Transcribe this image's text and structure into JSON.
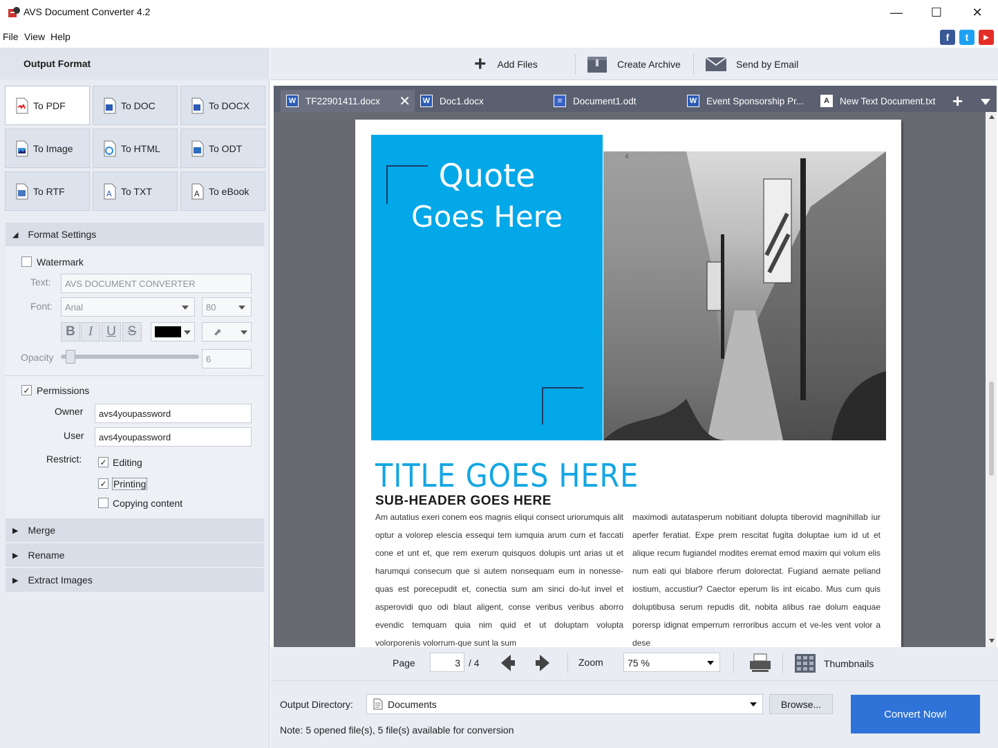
{
  "window": {
    "title": "AVS Document Converter 4.2"
  },
  "menu": [
    "File",
    "View",
    "Help"
  ],
  "social": [
    "f",
    "t",
    "▶"
  ],
  "colors": {
    "accent": "#2f73d8",
    "quote_box": "#02a8e8",
    "title_blue": "#14a6e3"
  },
  "left": {
    "output_format_label": "Output Format",
    "formats": [
      "To PDF",
      "To DOC",
      "To DOCX",
      "To Image",
      "To HTML",
      "To ODT",
      "To RTF",
      "To TXT",
      "To eBook"
    ],
    "selected_format": "To PDF",
    "format_settings": {
      "label": "Format Settings",
      "watermark_label": "Watermark",
      "watermark_checked": false,
      "text_label": "Text:",
      "text_value": "AVS DOCUMENT CONVERTER",
      "font_label": "Font:",
      "font_value": "Arial",
      "font_size": "80",
      "bold": "B",
      "italic": "I",
      "underline": "U",
      "strike": "S",
      "opacity_label": "Opacity",
      "opacity_value": "6",
      "permissions_label": "Permissions",
      "permissions_checked": true,
      "owner_label": "Owner",
      "owner_value": "avs4youpassword",
      "user_label": "User",
      "user_value": "avs4youpassword",
      "restrict_label": "Restrict:",
      "restrict_items": [
        "Editing",
        "Printing",
        "Copying content"
      ],
      "restrict_checked": [
        true,
        true,
        false
      ]
    },
    "sections": [
      "Merge",
      "Rename",
      "Extract Images"
    ]
  },
  "toolbar": {
    "add_files": "Add Files",
    "create_archive": "Create Archive",
    "send_email": "Send by Email"
  },
  "tabs": [
    "TF22901411.docx",
    "Doc1.docx",
    "Document1.odt",
    "Event Sponsorship Pr...",
    "New Text Document.txt"
  ],
  "document": {
    "quote_line1": "Quote",
    "quote_line2": "Goes Here",
    "photo_mark": "4",
    "title": "TITLE GOES HERE",
    "subheader": "SUB-HEADER GOES HERE",
    "col1": "Am autatius exeri conem eos magnis eliqui consect uriorumquis alit optur a volorep elescia essequi tem iumquia arum cum et faccati cone et unt et, que rem exerum quisquos dolupis unt arias ut et harumqui consecum que si autem nonsequam eum in nonesse-quas est porecepudit et, conectia sum am sinci do-lut invel et asperovidi quo odi blaut aligent, conse veribus veribus aborro evendic temquam quia nim quid et ut doluptam volupta volorporenis volorrum-que sunt la sum",
    "col2": "maximodi autatasperum nobitiant dolupta tiberovid magnihillab iur aperfer feratiat. Expe prem rescitat fugita doluptae ium id ut et alique recum fugiandel modites eremat emod maxim qui volum elis num eati qui blabore rferum dolorectat. Fugiand aemate peliand iostium, accustiur? Caector eperum lis int eicabo. Mus cum quis doluptibusa serum repudis dit, nobita alibus rae dolum eaquae porersp idignat emperrum rerroribus accum et ve-les vent volor a dese"
  },
  "nav": {
    "page_label": "Page",
    "page_value": "3",
    "page_total": "/ 4",
    "zoom_label": "Zoom",
    "zoom_value": "75 %",
    "thumbnails": "Thumbnails"
  },
  "output": {
    "dir_label": "Output Directory:",
    "dir_value": "Documents",
    "browse": "Browse...",
    "convert": "Convert Now!",
    "note": "Note: 5 opened file(s), 5 file(s) available for conversion"
  }
}
